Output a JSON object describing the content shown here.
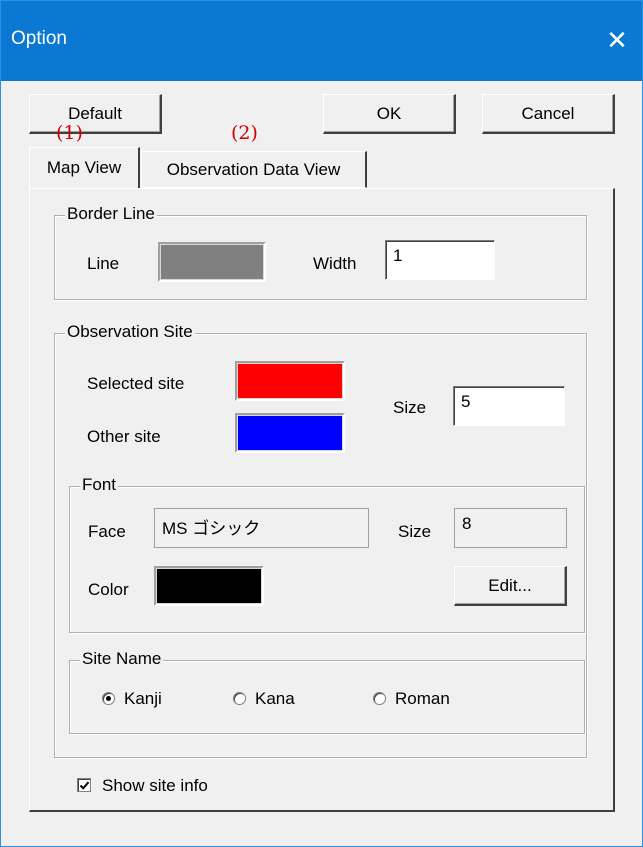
{
  "window": {
    "title": "Option",
    "close_glyph": "✕"
  },
  "buttons": {
    "default_label": "Default",
    "ok_label": "OK",
    "cancel_label": "Cancel"
  },
  "annotations": {
    "tab1": "(1)",
    "tab2": "(2)"
  },
  "tabs": [
    {
      "label": "Map View",
      "selected": true
    },
    {
      "label": "Observation Data View",
      "selected": false
    }
  ],
  "border_line": {
    "legend": "Border Line",
    "line_label": "Line",
    "line_color": "#808080",
    "width_label": "Width",
    "width_value": "1"
  },
  "observation_site": {
    "legend": "Observation Site",
    "selected_label": "Selected site",
    "selected_color": "#ff0000",
    "other_label": "Other site",
    "other_color": "#0000ff",
    "size_label": "Size",
    "size_value": "5"
  },
  "font": {
    "legend": "Font",
    "face_label": "Face",
    "face_value": "MS ゴシック",
    "size_label": "Size",
    "size_value": "8",
    "color_label": "Color",
    "color_value": "#000000",
    "edit_label": "Edit..."
  },
  "site_name": {
    "legend": "Site Name",
    "options": [
      {
        "label": "Kanji",
        "checked": true
      },
      {
        "label": "Kana",
        "checked": false
      },
      {
        "label": "Roman",
        "checked": false
      }
    ]
  },
  "show_site_info": {
    "label": "Show site info",
    "checked": true
  }
}
